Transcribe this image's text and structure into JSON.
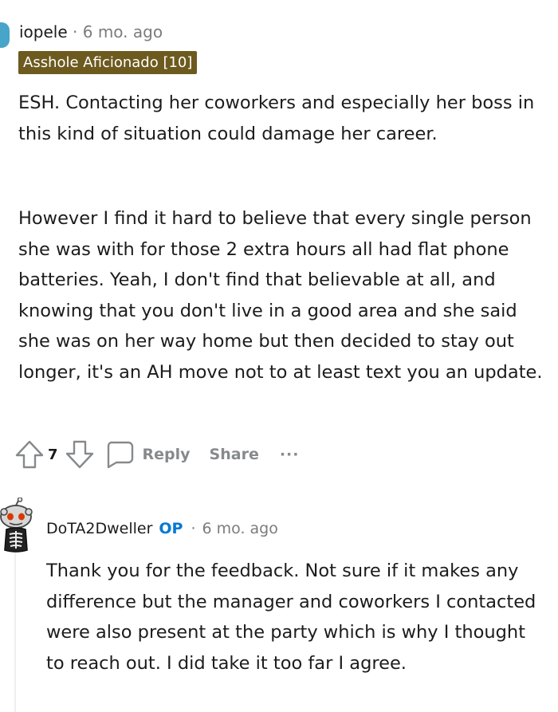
{
  "comment1": {
    "username": "iopele",
    "timestamp": "6 mo. ago",
    "separator": " · ",
    "flair": "Asshole Aficionado [10]",
    "paragraphs": [
      "ESH. Contacting her coworkers and especially her boss in this kind of situation could damage her career.",
      "However I find it hard to believe that every single person she was with for those 2 extra hours all had flat phone batteries. Yeah, I don't find that believable at all, and knowing that you don't live in a good area and she said she was on her way home but then decided to stay out longer, it's an AH move not to at least text you an update."
    ],
    "actions": {
      "vote_count": "7",
      "reply_label": "Reply",
      "share_label": "Share",
      "more_label": "···"
    }
  },
  "reply": {
    "username": "DoTA2Dweller",
    "op_badge": "OP",
    "separator": "·",
    "timestamp": "6 mo. ago",
    "paragraphs": [
      "Thank you for the feedback. Not sure if it makes any difference but the manager and coworkers I contacted were also present at the party which is why I thought to reach out. I did take it too far I agree."
    ]
  },
  "colors": {
    "flair_bg": "#6d5a1f",
    "op_blue": "#0079d3",
    "meta_gray": "#7c7c7c",
    "action_gray": "#878a8c"
  },
  "icons": [
    "upvote-icon",
    "downvote-icon",
    "comment-bubble-icon",
    "more-options-icon",
    "snoo-avatar-icon"
  ]
}
